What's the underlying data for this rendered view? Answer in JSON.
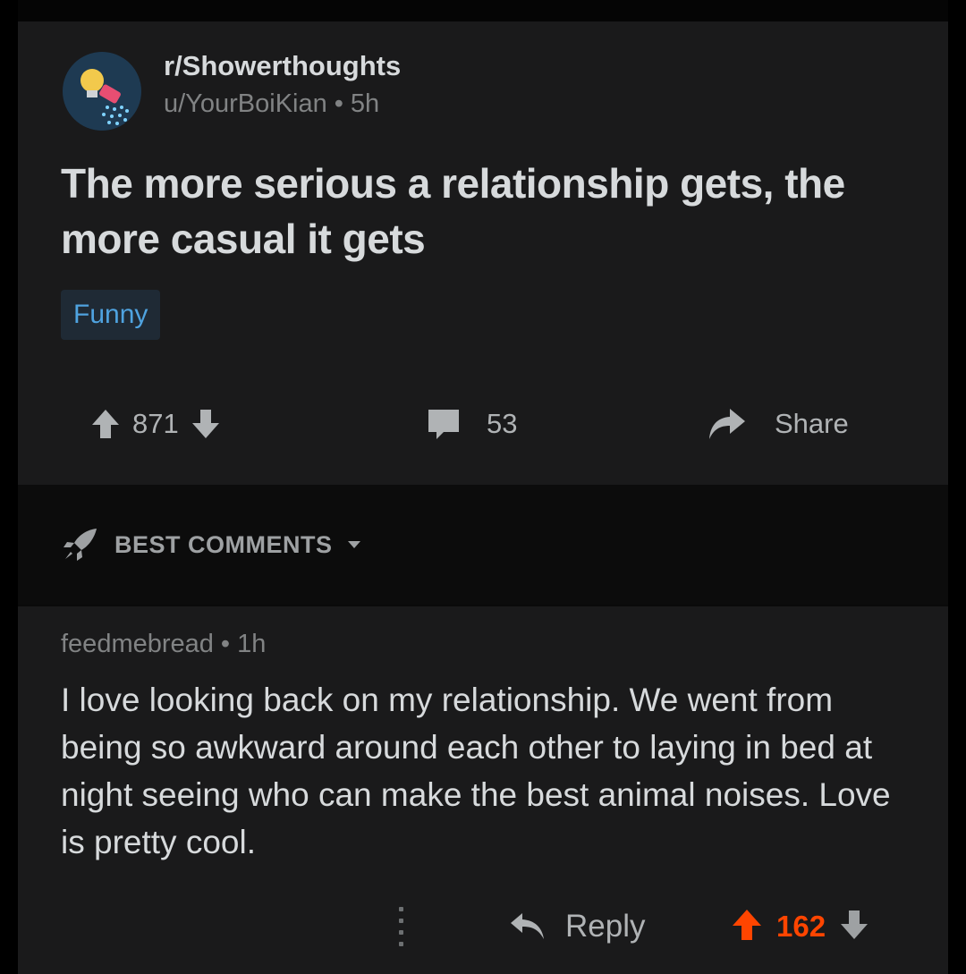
{
  "post": {
    "subreddit": "r/Showerthoughts",
    "author": "u/YourBoiKian",
    "separator": "•",
    "age": "5h",
    "title": "The more serious a relationship gets, the more casual it gets",
    "flair": "Funny",
    "upvotes": "871",
    "comments": "53",
    "share_label": "Share"
  },
  "sort": {
    "label": "BEST COMMENTS"
  },
  "comment": {
    "author": "feedmebread",
    "separator": "•",
    "age": "1h",
    "body": "I love looking back on my relationship. We went from being so awkward around each other to laying in bed at night seeing who can make the best animal noises. Love is pretty cool.",
    "reply_label": "Reply",
    "upvotes": "162"
  },
  "colors": {
    "background": "#1a1a1b",
    "text": "#d7dadc",
    "muted": "#818384",
    "flair": "#4fa3e0",
    "upvoted": "#ff4500"
  },
  "icons": {
    "avatar": "shower-lightbulb-icon",
    "upvote": "arrow-up-icon",
    "downvote": "arrow-down-icon",
    "comment": "speech-bubble-icon",
    "share": "share-arrow-icon",
    "sort": "rocket-icon",
    "reply": "reply-arrow-icon",
    "more": "vertical-dots-icon"
  }
}
